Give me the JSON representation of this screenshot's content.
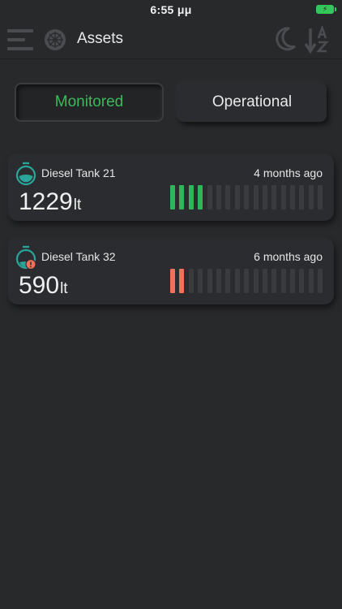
{
  "status_bar": {
    "time": "6:55 μμ"
  },
  "header": {
    "title": "Assets"
  },
  "tabs": [
    {
      "label": "Monitored",
      "active": true
    },
    {
      "label": "Operational",
      "active": false
    }
  ],
  "assets": [
    {
      "name": "Diesel Tank 21",
      "time": "4 months ago",
      "value": "1229",
      "unit": "lt",
      "level_filled": 4,
      "level_total": 17,
      "level_color": "#2fb55a",
      "alert": false
    },
    {
      "name": "Diesel Tank 32",
      "time": "6 months ago",
      "value": "590",
      "unit": "lt",
      "level_filled": 2,
      "level_total": 17,
      "level_color": "#f07157",
      "alert": true
    }
  ],
  "colors": {
    "background": "#28292b",
    "accent_green": "#3cb95a",
    "alert_red": "#f07157",
    "teal": "#2aa59a"
  },
  "icons": [
    "menu-icon",
    "ship-wheel-icon",
    "moon-icon",
    "sort-alpha-icon",
    "tank-icon",
    "alert-icon",
    "battery-icon"
  ]
}
